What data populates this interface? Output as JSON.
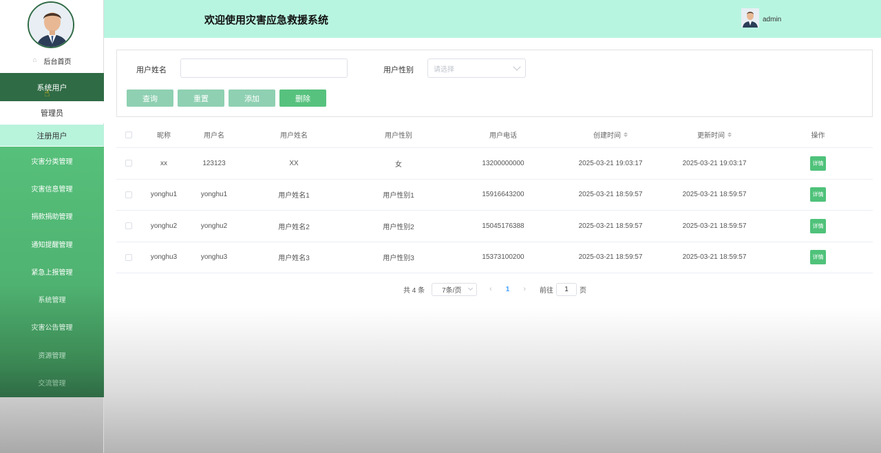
{
  "header": {
    "title": "欢迎使用灾害应急救援系统",
    "username": "admin"
  },
  "sidebar": {
    "home_label": "后台首页",
    "active_menu": "系统用户",
    "submenu": [
      "管理员",
      "注册用户"
    ],
    "menu_items": [
      "灾害分类管理",
      "灾害信息管理",
      "捐款捐助管理",
      "通知提醒管理",
      "紧急上报管理",
      "系统管理",
      "灾害公告管理",
      "资源管理",
      "交流管理"
    ]
  },
  "search": {
    "name_label": "用户姓名",
    "name_value": "",
    "gender_label": "用户性别",
    "gender_placeholder": "请选择",
    "buttons": {
      "query": "查询",
      "reset": "重置",
      "add": "添加",
      "delete": "删除"
    }
  },
  "table": {
    "headers": [
      "昵称",
      "用户名",
      "用户姓名",
      "用户性别",
      "用户电话",
      "创建时间",
      "更新时间",
      "操作"
    ],
    "rows": [
      {
        "nickname": "xx",
        "username": "123123",
        "realname": "XX",
        "gender": "女",
        "phone": "13200000000",
        "created": "2025-03-21 19:03:17",
        "updated": "2025-03-21 19:03:17",
        "action": "详情"
      },
      {
        "nickname": "yonghu1",
        "username": "yonghu1",
        "realname": "用户姓名1",
        "gender": "用户性别1",
        "phone": "15916643200",
        "created": "2025-03-21 18:59:57",
        "updated": "2025-03-21 18:59:57",
        "action": "详情"
      },
      {
        "nickname": "yonghu2",
        "username": "yonghu2",
        "realname": "用户姓名2",
        "gender": "用户性别2",
        "phone": "15045176388",
        "created": "2025-03-21 18:59:57",
        "updated": "2025-03-21 18:59:57",
        "action": "详情"
      },
      {
        "nickname": "yonghu3",
        "username": "yonghu3",
        "realname": "用户姓名3",
        "gender": "用户性别3",
        "phone": "15373100200",
        "created": "2025-03-21 18:59:57",
        "updated": "2025-03-21 18:59:57",
        "action": "详情"
      }
    ]
  },
  "pagination": {
    "total": "共 4 条",
    "page_size": "7条/页",
    "current_page": "1",
    "goto_label": "前往",
    "goto_value": "1",
    "goto_suffix": "页"
  },
  "colors": {
    "sidebar_dark": "#2f6b45",
    "sidebar_green": "#56c07a",
    "header_bg": "#b8f5e0",
    "detail_button": "#4fc27a"
  }
}
